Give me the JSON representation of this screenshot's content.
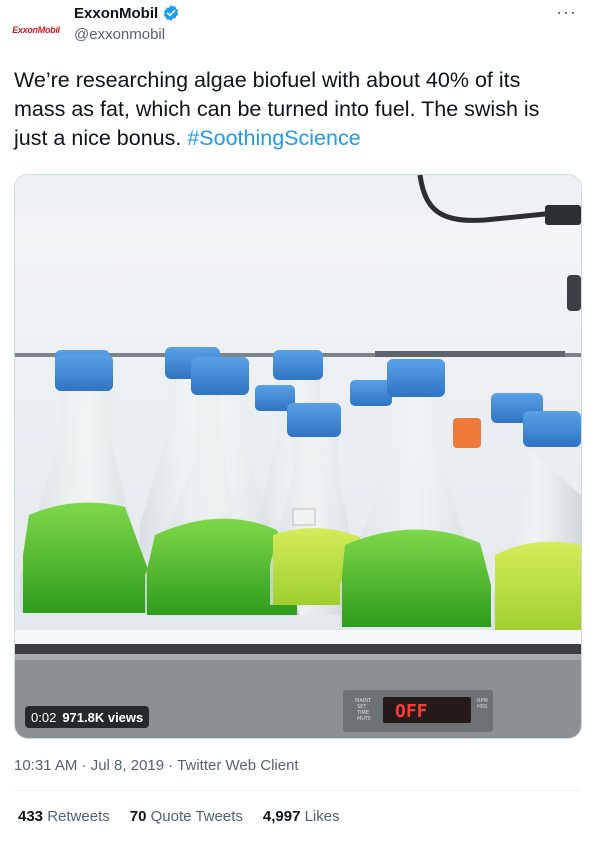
{
  "author": {
    "avatar_text": "ExxonMobil",
    "name": "ExxonMobil",
    "handle": "@exxonmobil",
    "verified": true,
    "more_icon": "more-horizontal-icon"
  },
  "tweet": {
    "text": "We’re researching algae biofuel with about 40% of its mass as fat, which can be turned into fuel. The swish is just a nice bonus.",
    "hashtag": "#SoothingScience",
    "timestamp": "10:31 AM · Jul 8, 2019 · Twitter Web Client"
  },
  "video": {
    "elapsed": "0:02",
    "views": "971.8K views",
    "display_readout": "OFF",
    "panel_labels": [
      "MAINT",
      "SET",
      "TIME",
      "MUTE"
    ],
    "panel_labels_right": [
      "RPM",
      "HRS"
    ]
  },
  "stats": {
    "retweets": {
      "count": "433",
      "label": "Retweets"
    },
    "quotes": {
      "count": "70",
      "label": "Quote Tweets"
    },
    "likes": {
      "count": "4,997",
      "label": "Likes"
    }
  },
  "colors": {
    "accent": "#1d9bf0",
    "text": "#0f1419",
    "secondary": "#536471",
    "brand_red": "#d71920"
  }
}
